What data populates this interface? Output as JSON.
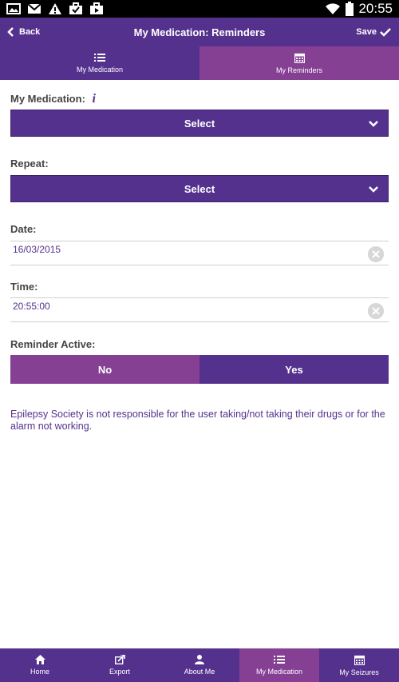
{
  "status_bar": {
    "time": "20:55"
  },
  "header": {
    "back_label": "Back",
    "title": "My Medication: Reminders",
    "save_label": "Save"
  },
  "tabs": [
    {
      "label": "My Medication",
      "icon": "list-icon"
    },
    {
      "label": "My Reminders",
      "icon": "calendar-icon"
    }
  ],
  "form": {
    "medication_label": "My Medication:",
    "medication_info_icon": "info-icon",
    "medication_value": "Select",
    "repeat_label": "Repeat:",
    "repeat_value": "Select",
    "date_label": "Date:",
    "date_value": "16/03/2015",
    "time_label": "Time:",
    "time_value": "20:55:00",
    "reminder_label": "Reminder Active:",
    "reminder_no": "No",
    "reminder_yes": "Yes"
  },
  "disclaimer": "Epilepsy Society is not responsible for the user taking/not taking their drugs or for the alarm not working.",
  "bottom_nav": [
    {
      "label": "Home",
      "icon": "home-icon"
    },
    {
      "label": "Export",
      "icon": "export-icon"
    },
    {
      "label": "About Me",
      "icon": "person-icon"
    },
    {
      "label": "My Medication",
      "icon": "list-icon",
      "active": true
    },
    {
      "label": "My Seizures",
      "icon": "calendar-icon"
    }
  ],
  "colors": {
    "primary": "#55318e",
    "accent": "#853f93",
    "text": "#444444"
  }
}
